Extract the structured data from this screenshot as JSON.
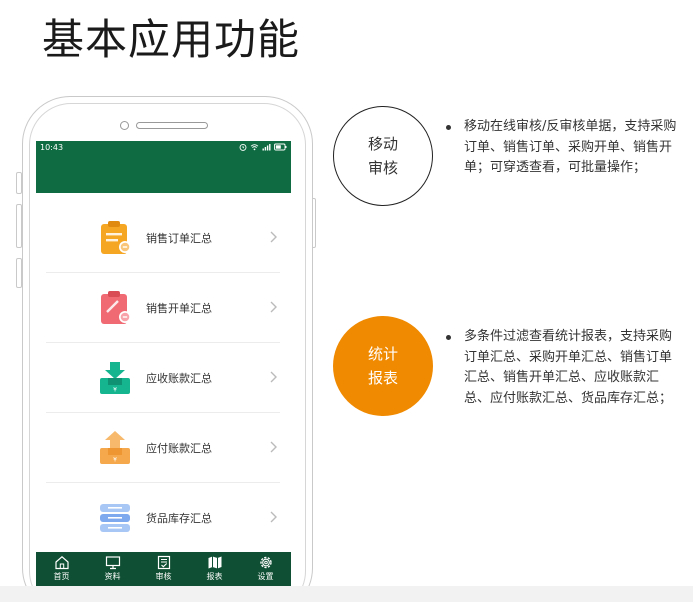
{
  "page": {
    "title": "基本应用功能"
  },
  "phone": {
    "status_time": "10:43",
    "menu": [
      {
        "label": "销售订单汇总",
        "icon": "clipboard-orange-icon"
      },
      {
        "label": "销售开单汇总",
        "icon": "clipboard-red-icon"
      },
      {
        "label": "应收账款汇总",
        "icon": "receivable-tray-icon"
      },
      {
        "label": "应付账款汇总",
        "icon": "payable-tray-icon"
      },
      {
        "label": "货品库存汇总",
        "icon": "inventory-stack-icon"
      }
    ],
    "tabs": [
      {
        "label": "首页",
        "icon": "home-icon"
      },
      {
        "label": "资料",
        "icon": "monitor-icon"
      },
      {
        "label": "审核",
        "icon": "audit-icon"
      },
      {
        "label": "报表",
        "icon": "report-icon"
      },
      {
        "label": "设置",
        "icon": "gear-icon"
      }
    ]
  },
  "features": [
    {
      "title_line1": "移动",
      "title_line2": "审核",
      "description": "移动在线审核/反审核单据，支持采购订单、销售订单、采购开单、销售开单；可穿透查看，可批量操作；"
    },
    {
      "title_line1": "统计",
      "title_line2": "报表",
      "description": "多条件过滤查看统计报表，支持采购订单汇总、采购开单汇总、销售订单汇总、销售开单汇总、应收账款汇总、应付账款汇总、货品库存汇总；"
    }
  ],
  "colors": {
    "header_green": "#0f6b42",
    "tabbar_green": "#0f4f33",
    "accent_orange": "#f08a00"
  }
}
